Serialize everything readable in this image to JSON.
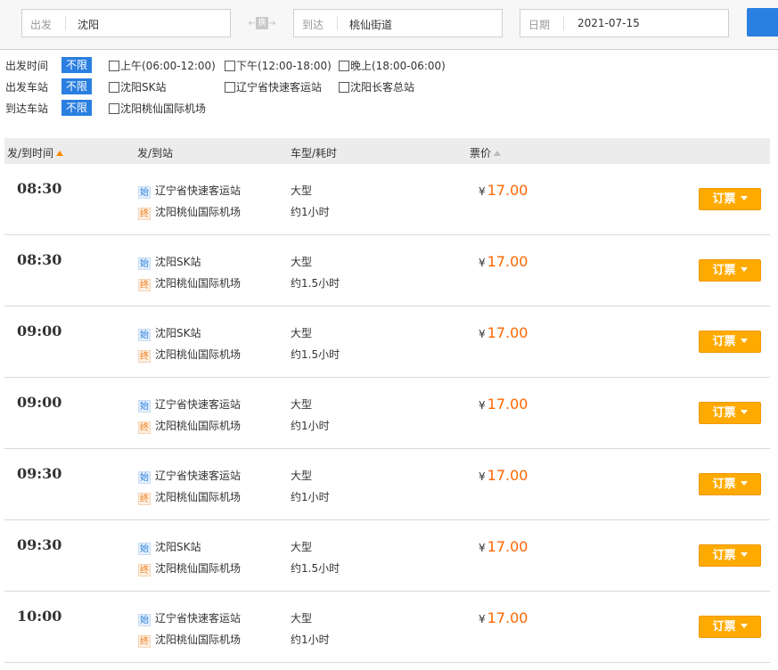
{
  "search": {
    "from_label": "出发",
    "from_value": "沈阳",
    "swap_label": "换",
    "to_label": "到达",
    "to_value": "桃仙街道",
    "date_label": "日期",
    "date_value": "2021-07-15",
    "accent_color": "#2a7fe0"
  },
  "filters": {
    "rows": [
      {
        "label": "出发时间",
        "any": "不限",
        "options": [
          "上午(06:00-12:00)",
          "下午(12:00-18:00)",
          "晚上(18:00-06:00)"
        ]
      },
      {
        "label": "出发车站",
        "any": "不限",
        "options": [
          "沈阳SK站",
          "辽宁省快速客运站",
          "沈阳长客总站"
        ]
      },
      {
        "label": "到达车站",
        "any": "不限",
        "options": [
          "沈阳桃仙国际机场"
        ]
      }
    ]
  },
  "table": {
    "headers": {
      "time": "发/到时间",
      "station": "发/到站",
      "bus": "车型/耗时",
      "price": "票价"
    },
    "start_tag": "始",
    "end_tag": "终",
    "currency": "¥",
    "book_label": "订票",
    "rows": [
      {
        "time": "08:30",
        "from": "辽宁省快速客运站",
        "to": "沈阳桃仙国际机场",
        "bus": "大型",
        "duration": "约1小时",
        "price": "17.00"
      },
      {
        "time": "08:30",
        "from": "沈阳SK站",
        "to": "沈阳桃仙国际机场",
        "bus": "大型",
        "duration": "约1.5小时",
        "price": "17.00"
      },
      {
        "time": "09:00",
        "from": "沈阳SK站",
        "to": "沈阳桃仙国际机场",
        "bus": "大型",
        "duration": "约1.5小时",
        "price": "17.00"
      },
      {
        "time": "09:00",
        "from": "辽宁省快速客运站",
        "to": "沈阳桃仙国际机场",
        "bus": "大型",
        "duration": "约1小时",
        "price": "17.00"
      },
      {
        "time": "09:30",
        "from": "辽宁省快速客运站",
        "to": "沈阳桃仙国际机场",
        "bus": "大型",
        "duration": "约1小时",
        "price": "17.00"
      },
      {
        "time": "09:30",
        "from": "沈阳SK站",
        "to": "沈阳桃仙国际机场",
        "bus": "大型",
        "duration": "约1.5小时",
        "price": "17.00"
      },
      {
        "time": "10:00",
        "from": "辽宁省快速客运站",
        "to": "沈阳桃仙国际机场",
        "bus": "大型",
        "duration": "约1小时",
        "price": "17.00"
      }
    ]
  }
}
